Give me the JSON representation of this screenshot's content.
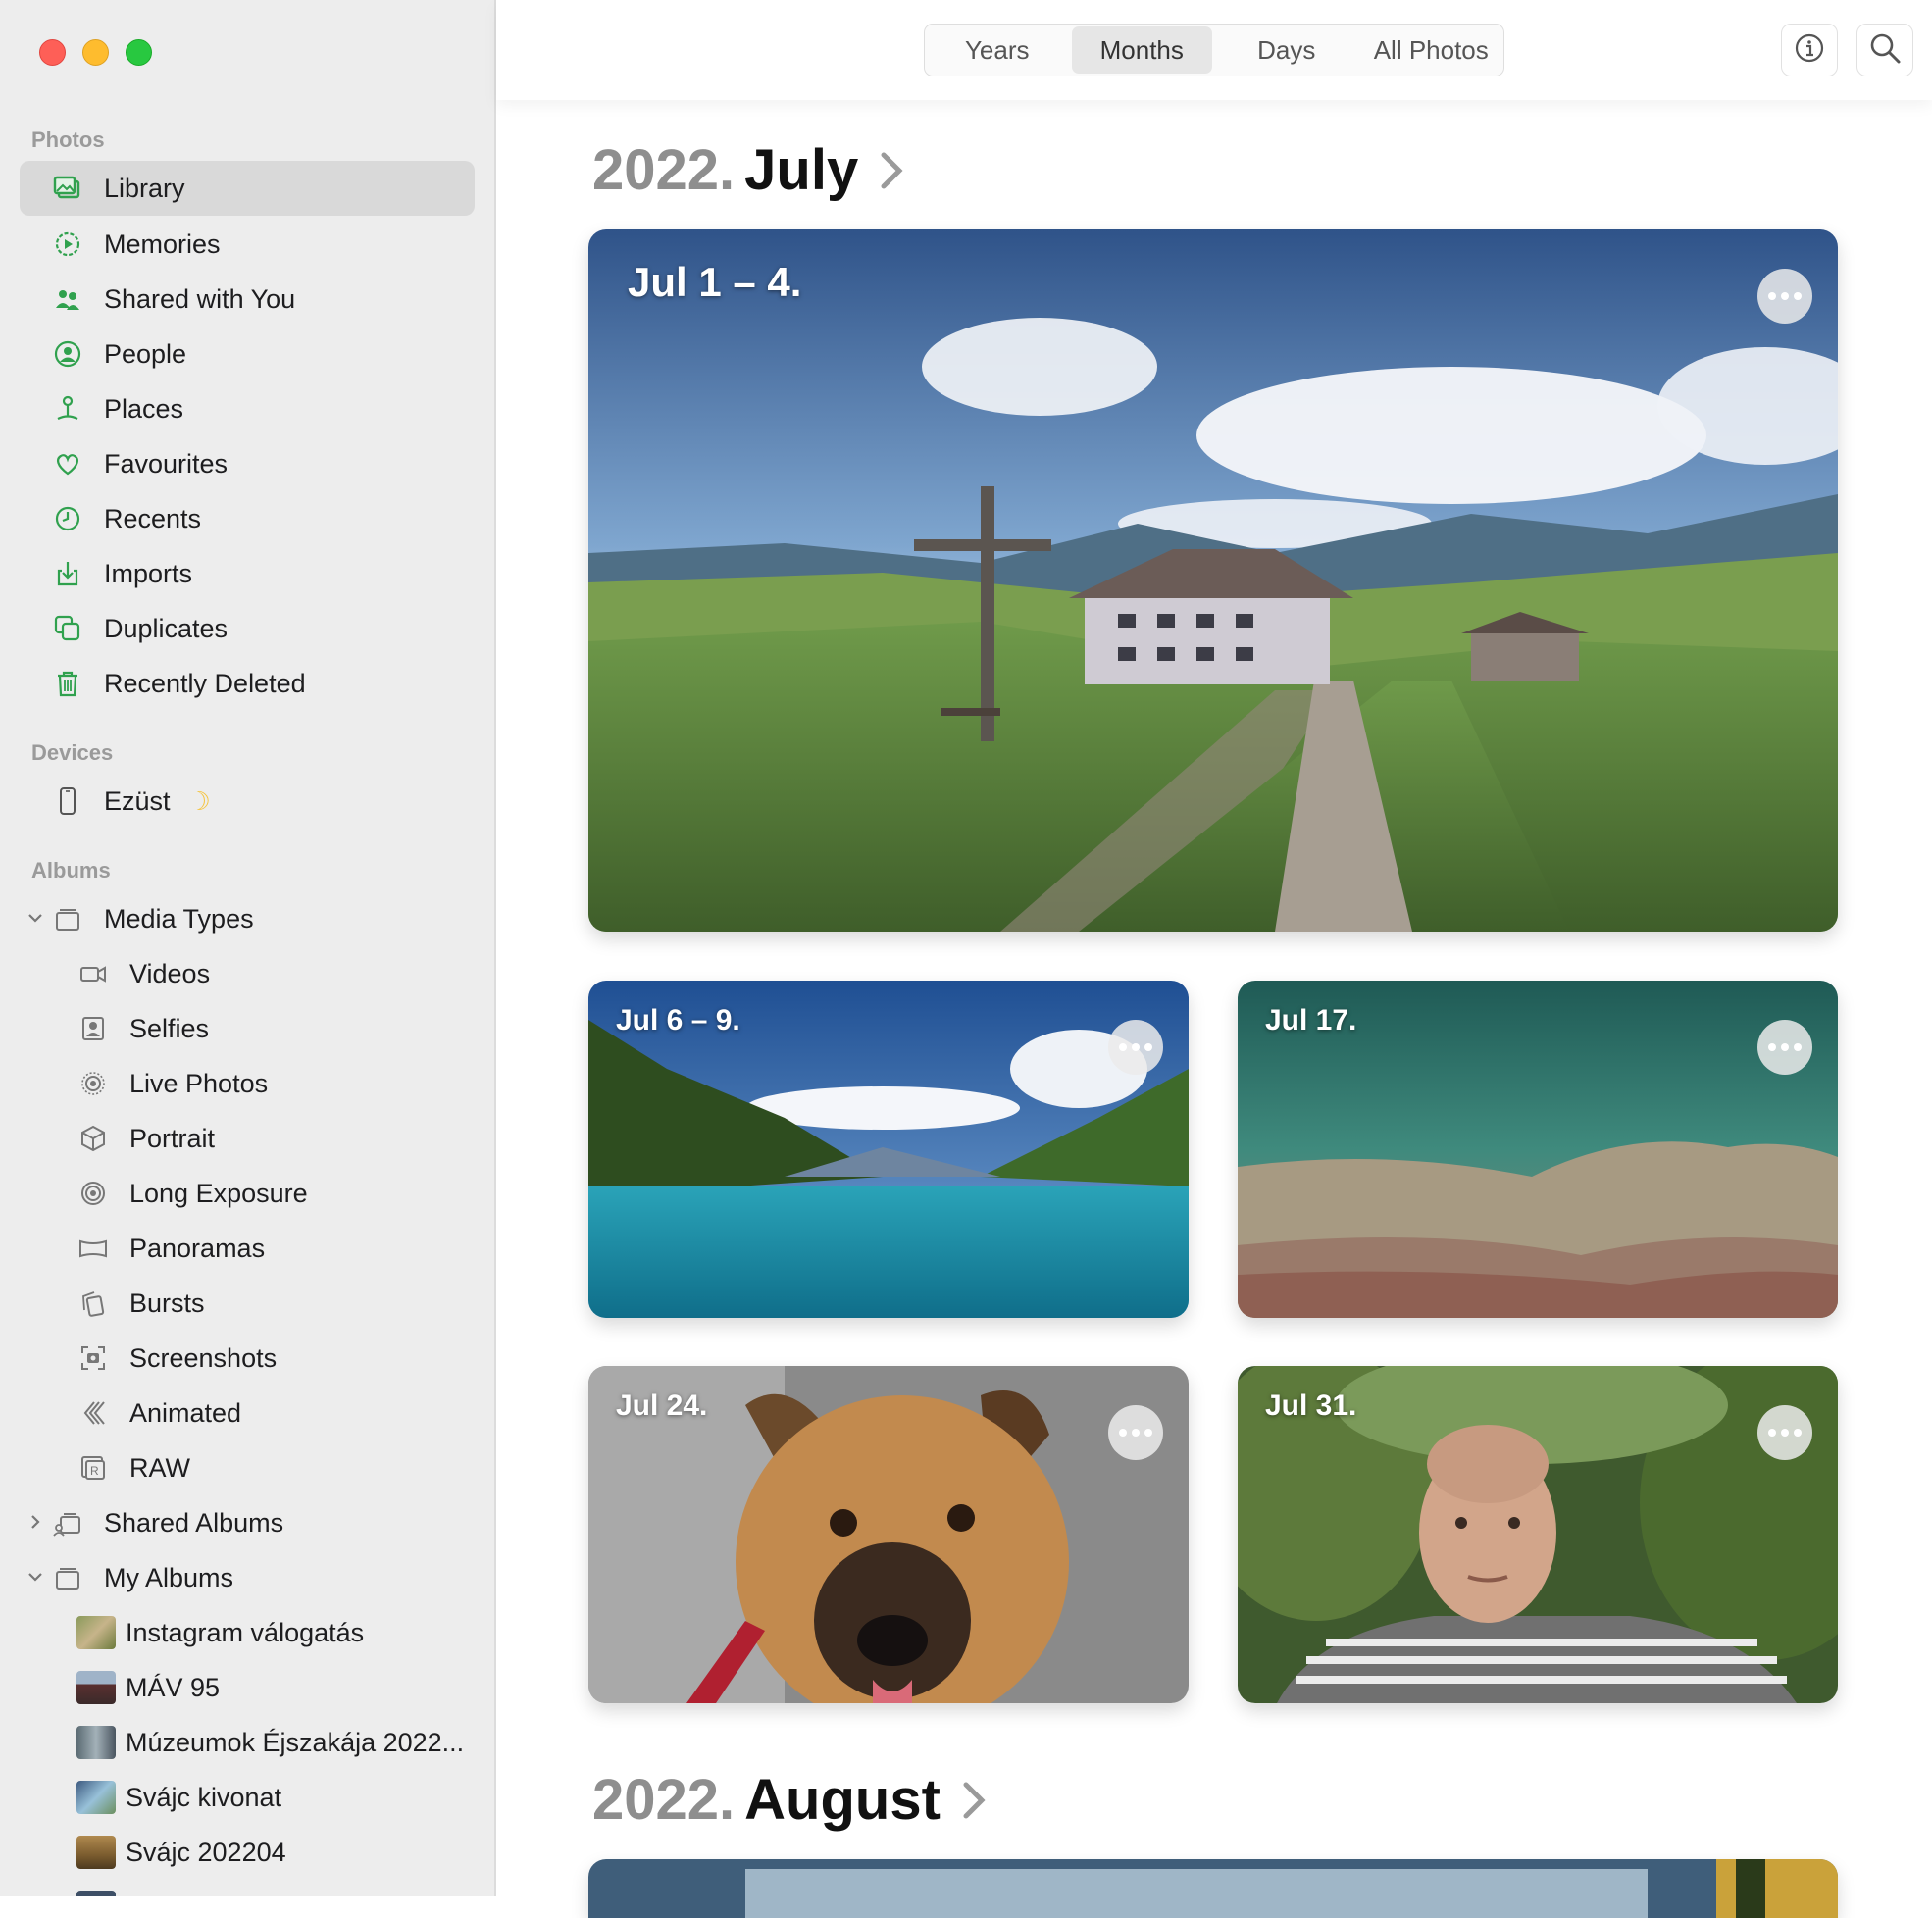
{
  "sidebar": {
    "sections": {
      "photos": "Photos",
      "devices": "Devices",
      "albums": "Albums"
    },
    "items": {
      "library": "Library",
      "memories": "Memories",
      "shared_with_you": "Shared with You",
      "people": "People",
      "places": "Places",
      "favourites": "Favourites",
      "recents": "Recents",
      "imports": "Imports",
      "duplicates": "Duplicates",
      "recently_deleted": "Recently Deleted"
    },
    "devices": {
      "device1": "Ezüst",
      "device1_badge": "☽"
    },
    "media_types": {
      "label": "Media Types",
      "videos": "Videos",
      "selfies": "Selfies",
      "live_photos": "Live Photos",
      "portrait": "Portrait",
      "long_exposure": "Long Exposure",
      "panoramas": "Panoramas",
      "bursts": "Bursts",
      "screenshots": "Screenshots",
      "animated": "Animated",
      "raw": "RAW"
    },
    "shared_albums": "Shared Albums",
    "my_albums": {
      "label": "My Albums",
      "a1": "Instagram válogatás",
      "a2": "MÁV 95",
      "a3": "Múzeumok Éjszakája 2022...",
      "a4": "Svájc kivonat",
      "a5": "Svájc 202204"
    }
  },
  "toolbar": {
    "tabs": {
      "years": "Years",
      "months": "Months",
      "days": "Days",
      "all": "All Photos"
    },
    "active_tab": "Months"
  },
  "timeline": {
    "july": {
      "year": "2022.",
      "month": "July"
    },
    "august": {
      "year": "2022.",
      "month": "August"
    },
    "cards": {
      "c1": "Jul 1 – 4.",
      "c2": "Jul 6 – 9.",
      "c3": "Jul 17.",
      "c4": "Jul 24.",
      "c5": "Jul 31."
    }
  },
  "colors": {
    "accent": "#30a14e",
    "selected_bg": "#d9d9d9",
    "sidebar_bg": "#ededed"
  }
}
